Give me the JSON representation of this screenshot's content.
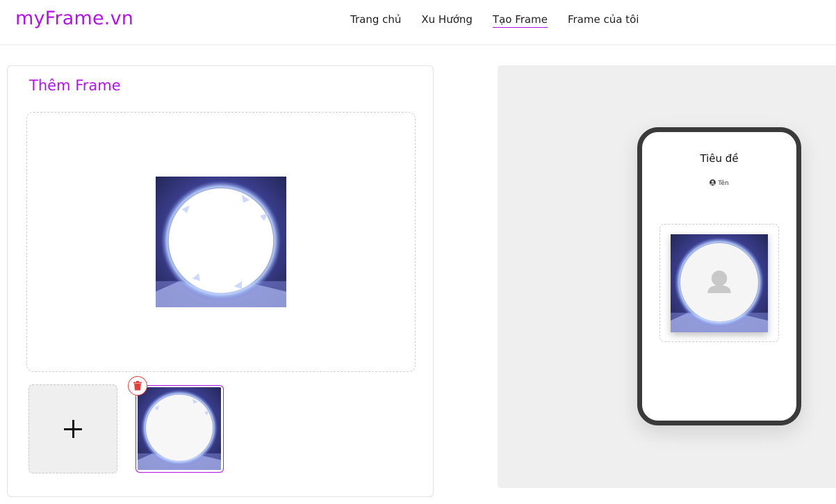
{
  "header": {
    "logo": "myFrame.vn",
    "nav": [
      {
        "label": "Trang chủ"
      },
      {
        "label": "Xu Hướng"
      },
      {
        "label": "Tạo Frame"
      },
      {
        "label": "Frame của tôi"
      }
    ],
    "active_nav": "Tạo Frame"
  },
  "editor": {
    "title": "Thêm Frame",
    "add_icon": "plus-icon",
    "delete_icon": "trash-icon"
  },
  "preview": {
    "title": "Tiêu đề",
    "author": "Tên",
    "author_icon": "user-circle-icon",
    "avatar_icon": "person-silhouette-icon"
  },
  "colors": {
    "brand": "#b413e6",
    "delete": "#e34141",
    "panel_bg": "#efefef",
    "phone_border": "#3a3a3a"
  }
}
